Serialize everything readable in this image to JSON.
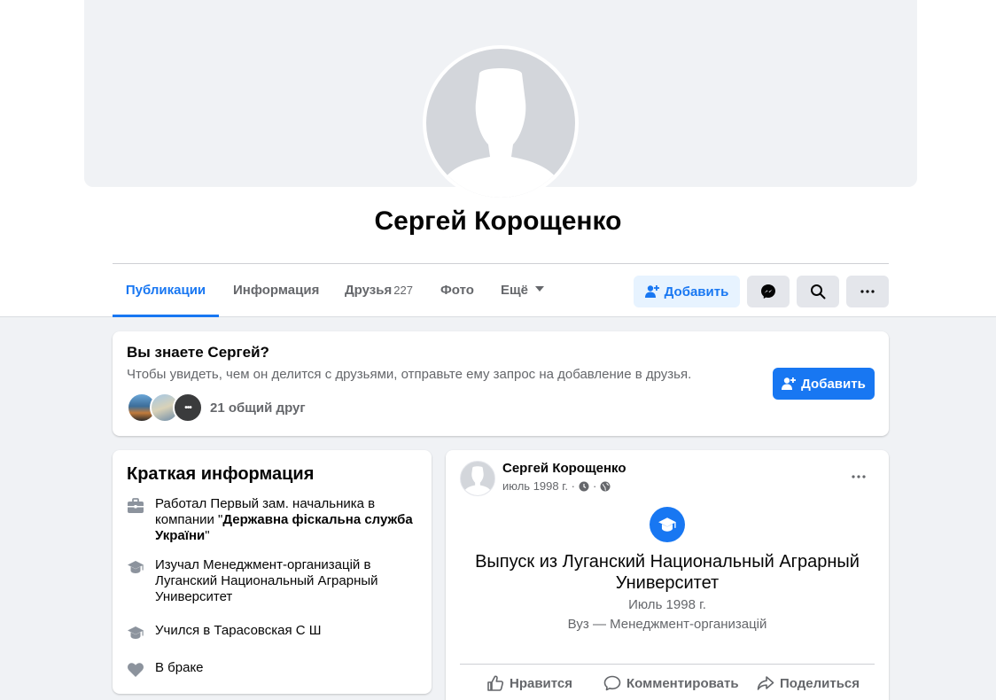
{
  "profile": {
    "name": "Сергей Корощенко"
  },
  "tabs": [
    {
      "label": "Публикации"
    },
    {
      "label": "Информация"
    },
    {
      "label": "Друзья",
      "count": "227"
    },
    {
      "label": "Фото"
    },
    {
      "label": "Ещё"
    }
  ],
  "actions": {
    "add_label": "Добавить"
  },
  "know_card": {
    "title": "Вы знаете Сергей?",
    "subtitle": "Чтобы увидеть, чем он делится с друзьями, отправьте ему запрос на добавление в друзья.",
    "add_label": "Добавить",
    "mutual_more": "•••",
    "mutual_text": "21 общий друг"
  },
  "intro": {
    "title": "Краткая информация",
    "work_prefix": "Работал Первый зам. начальника в компании \"",
    "work_company": "Державна фіскальна служба України",
    "work_suffix": "\"",
    "study": "Изучал Менеджмент-организацій в Луганский Национальный Аграрный Университет",
    "school": "Учился в Тарасовская С Ш",
    "relationship": "В браке"
  },
  "post": {
    "author": "Сергей Корощенко",
    "date": "июль 1998 г. ·",
    "headline": "Выпуск из Луганский Национальный Аграрный Университет",
    "event_date": "Июль 1998 г.",
    "field": "Вуз — Менеджмент-организацій",
    "like": "Нравится",
    "comment": "Комментировать",
    "share": "Поделиться"
  },
  "colors": {
    "accent": "#1877f2",
    "background": "#f0f2f5",
    "secondary_text": "#65676b"
  }
}
